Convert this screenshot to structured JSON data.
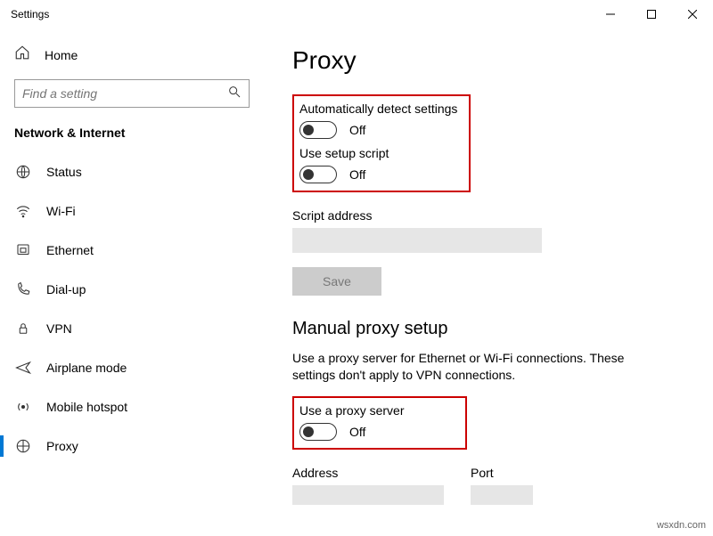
{
  "window": {
    "title": "Settings"
  },
  "sidebar": {
    "home_label": "Home",
    "search_placeholder": "Find a setting",
    "category": "Network & Internet",
    "items": [
      {
        "label": "Status"
      },
      {
        "label": "Wi-Fi"
      },
      {
        "label": "Ethernet"
      },
      {
        "label": "Dial-up"
      },
      {
        "label": "VPN"
      },
      {
        "label": "Airplane mode"
      },
      {
        "label": "Mobile hotspot"
      },
      {
        "label": "Proxy"
      }
    ]
  },
  "main": {
    "title": "Proxy",
    "auto_detect": {
      "label": "Automatically detect settings",
      "state": "Off"
    },
    "setup_script": {
      "label": "Use setup script",
      "state": "Off"
    },
    "script_address_label": "Script address",
    "save_label": "Save",
    "manual_section": {
      "title": "Manual proxy setup",
      "description": "Use a proxy server for Ethernet or Wi-Fi connections. These settings don't apply to VPN connections.",
      "use_proxy": {
        "label": "Use a proxy server",
        "state": "Off"
      },
      "address_label": "Address",
      "port_label": "Port"
    }
  },
  "watermark": "wsxdn.com"
}
